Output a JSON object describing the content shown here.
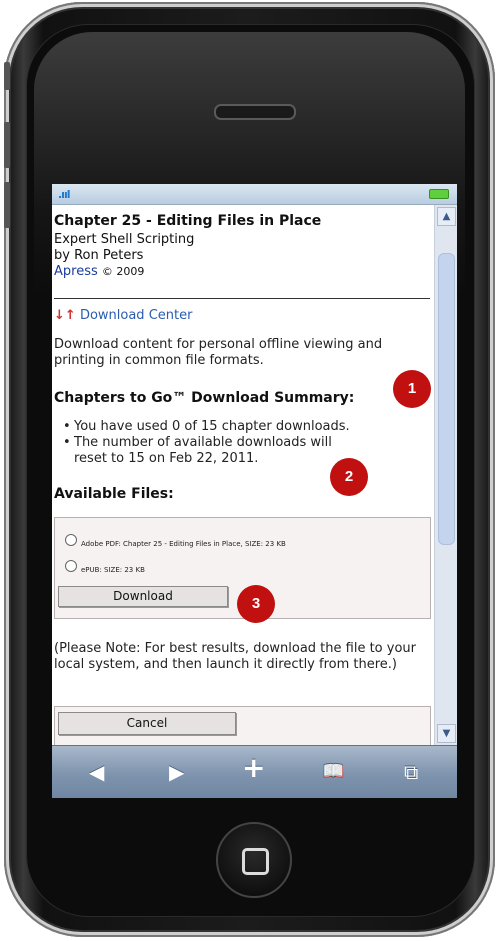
{
  "header": {
    "title": "Chapter 25 - Editing Files in Place",
    "book": "Expert Shell Scripting",
    "author": "by Ron Peters",
    "publisher": "Apress",
    "copyright": "© 2009"
  },
  "download_center": {
    "arrow": "↓↑",
    "label": "Download Center"
  },
  "intro_text": "Download content for personal offline viewing and printing in common file formats.",
  "summary": {
    "heading": "Chapters to Go™ Download Summary:",
    "items": [
      "You have used 0 of 15 chapter downloads.",
      "The number of available downloads will reset to 15 on Feb 22, 2011."
    ]
  },
  "files": {
    "heading": "Available Files:",
    "options": [
      "Adobe PDF: Chapter 25 - Editing Files in Place, SIZE: 23 KB",
      "ePUB: SIZE: 23 KB"
    ],
    "download_label": "Download"
  },
  "note_text": "(Please Note: For best results, download the file to your local system, and then launch it directly from there.)",
  "cancel_label": "Cancel",
  "statusbar": {
    "signal_icon": "signal-bars-icon",
    "battery_icon": "battery-icon"
  },
  "browser_toolbar": {
    "back": "◀",
    "forward": "▶",
    "add": "+",
    "bookmarks": "📖",
    "pages": "⧉"
  },
  "scrollbar": {
    "up": "▲",
    "down": "▼"
  },
  "callouts": [
    "1",
    "2",
    "3"
  ],
  "colors": {
    "callout": "#c01010",
    "link": "#2a5db0",
    "toolbar": "#7e93ad"
  }
}
